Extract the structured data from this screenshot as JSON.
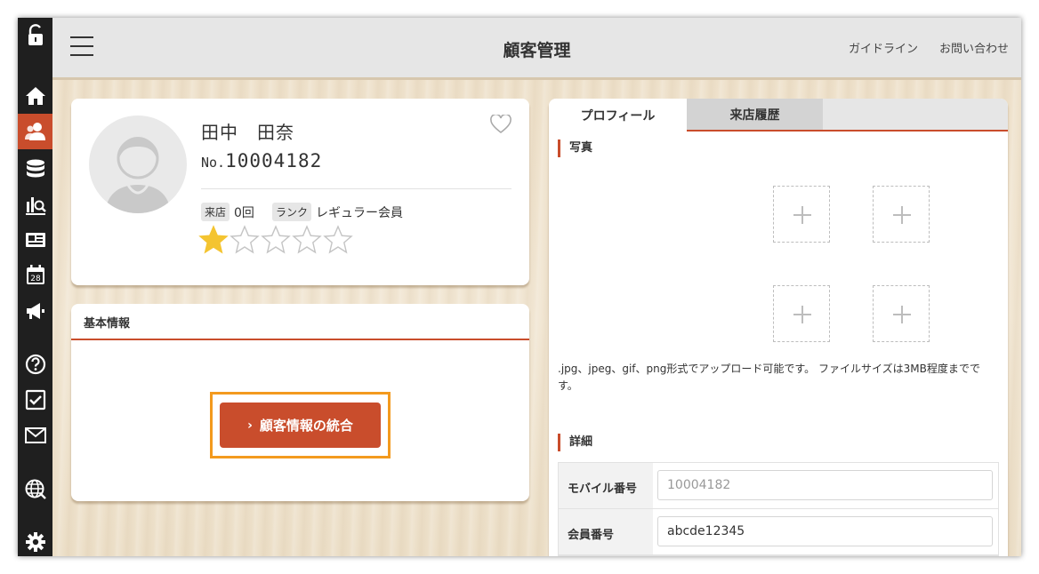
{
  "header": {
    "title": "顧客管理",
    "links": [
      "ガイドライン",
      "お問い合わせ"
    ]
  },
  "sidebar": {
    "items": [
      {
        "icon": "unlock-icon"
      },
      {
        "icon": "home-icon"
      },
      {
        "icon": "users-icon",
        "active": true
      },
      {
        "icon": "database-icon"
      },
      {
        "icon": "analytics-icon"
      },
      {
        "icon": "news-icon"
      },
      {
        "icon": "calendar-icon",
        "label": "28"
      },
      {
        "icon": "megaphone-icon"
      },
      {
        "icon": "help-icon"
      },
      {
        "icon": "checkbox-icon"
      },
      {
        "icon": "mail-icon"
      },
      {
        "icon": "globe-icon"
      },
      {
        "icon": "settings-icon"
      }
    ]
  },
  "customer": {
    "name": "田中　田奈",
    "no_prefix": "No.",
    "no": "10004182",
    "visits_label": "来店",
    "visits": "0回",
    "rank_label": "ランク",
    "rank": "レギュラー会員",
    "rating": 1,
    "rating_max": 5
  },
  "basic_info": {
    "title": "基本情報",
    "merge_button": "顧客情報の統合"
  },
  "tabs": [
    {
      "label": "プロフィール",
      "active": true
    },
    {
      "label": "来店履歴",
      "active": false
    }
  ],
  "profile": {
    "photo_title": "写真",
    "photo_note": ".jpg、jpeg、gif、png形式でアップロード可能です。 ファイルサイズは3MB程度までです。",
    "detail_title": "詳細",
    "fields": [
      {
        "label": "モバイル番号",
        "value": "",
        "placeholder": "10004182"
      },
      {
        "label": "会員番号",
        "value": "abcde12345",
        "placeholder": ""
      }
    ]
  },
  "colors": {
    "accent": "#c94d2c",
    "highlight": "#f39a1e",
    "star": "#f4c430",
    "sidebar": "#1f1f1f"
  }
}
